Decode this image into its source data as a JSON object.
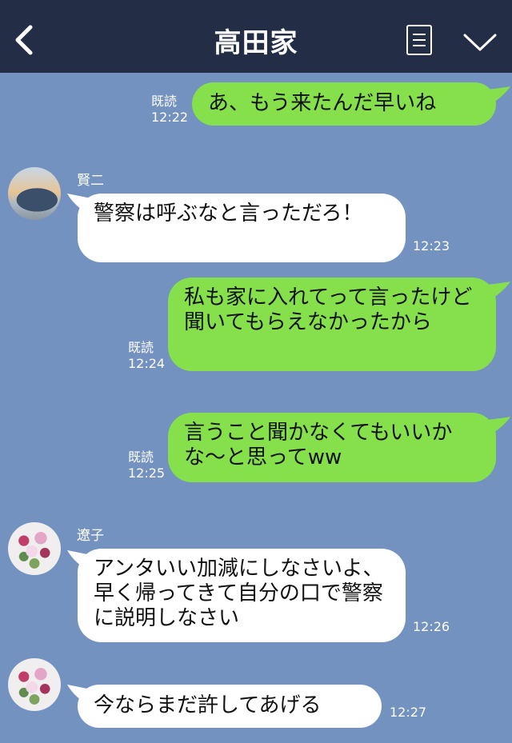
{
  "header": {
    "title": "高田家",
    "back_icon": "chevron-left-icon",
    "menu_icon": "list-icon",
    "dropdown_icon": "chevron-down-icon"
  },
  "colors": {
    "header_bg": "#232e46",
    "chat_bg": "#7492c0",
    "outgoing_bubble": "#86e04c",
    "incoming_bubble": "#ffffff"
  },
  "messages": [
    {
      "direction": "out",
      "text": "あ、もう来たんだ早いね",
      "read": "既読",
      "time": "12:22"
    },
    {
      "direction": "in",
      "sender": "賢二",
      "text": "警察は呼ぶなと言っただろ！",
      "time": "12:23"
    },
    {
      "direction": "out",
      "text": "私も家に入れてって言ったけど聞いてもらえなかったから",
      "read": "既読",
      "time": "12:24"
    },
    {
      "direction": "out",
      "text": "言うこと聞かなくてもいいかな〜と思ってww",
      "read": "既読",
      "time": "12:25"
    },
    {
      "direction": "in",
      "sender": "遼子",
      "text": "アンタいい加減にしなさいよ、早く帰ってきて自分の口で警察に説明しなさい",
      "time": "12:26"
    },
    {
      "direction": "in",
      "sender": "遼子",
      "text": "今ならまだ許してあげる",
      "time": "12:27"
    }
  ]
}
